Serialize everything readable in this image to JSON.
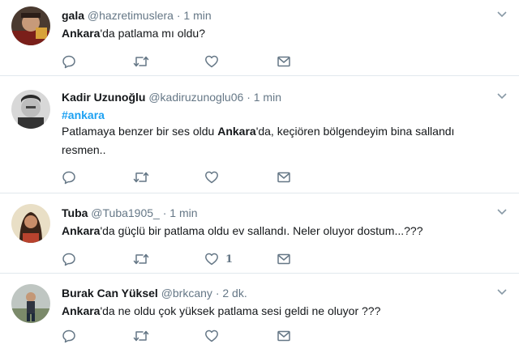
{
  "tweets": [
    {
      "name": "gala",
      "handle": "@hazretimuslera",
      "separator": "·",
      "time": "1 min",
      "text_bold": "Ankara",
      "text_rest": "'da patlama mı oldu?",
      "likes": ""
    },
    {
      "name": "Kadir Uzunoğlu",
      "handle": "@kadiruzunoglu06",
      "separator": "·",
      "time": "1 min",
      "hashtag": "#ankara",
      "text_pre": "Patlamaya benzer bir ses oldu ",
      "text_bold": "Ankara",
      "text_rest": "'da, keçiören bölgendeyim bina sallandı",
      "text_line2": "resmen..",
      "likes": ""
    },
    {
      "name": "Tuba",
      "handle": "@Tuba1905_",
      "separator": "·",
      "time": "1 min",
      "text_bold": "Ankara",
      "text_rest": "'da güçlü bir patlama oldu ev sallandı. Neler oluyor dostum...???",
      "likes": "1"
    },
    {
      "name": "Burak Can Yüksel",
      "handle": "@brkcany",
      "separator": "·",
      "time": "2 dk.",
      "text_bold": "Ankara",
      "text_rest": "'da ne oldu çok yüksek patlama sesi geldi ne oluyor ???",
      "likes": ""
    }
  ],
  "icons": {
    "reply": "reply-icon",
    "retweet": "retweet-icon",
    "like": "heart-icon",
    "dm": "envelope-icon",
    "caret": "chevron-down-icon"
  },
  "colors": {
    "text": "#14171a",
    "secondary": "#657786",
    "hashtag": "#1da1f2",
    "divider": "#e1e8ed"
  }
}
